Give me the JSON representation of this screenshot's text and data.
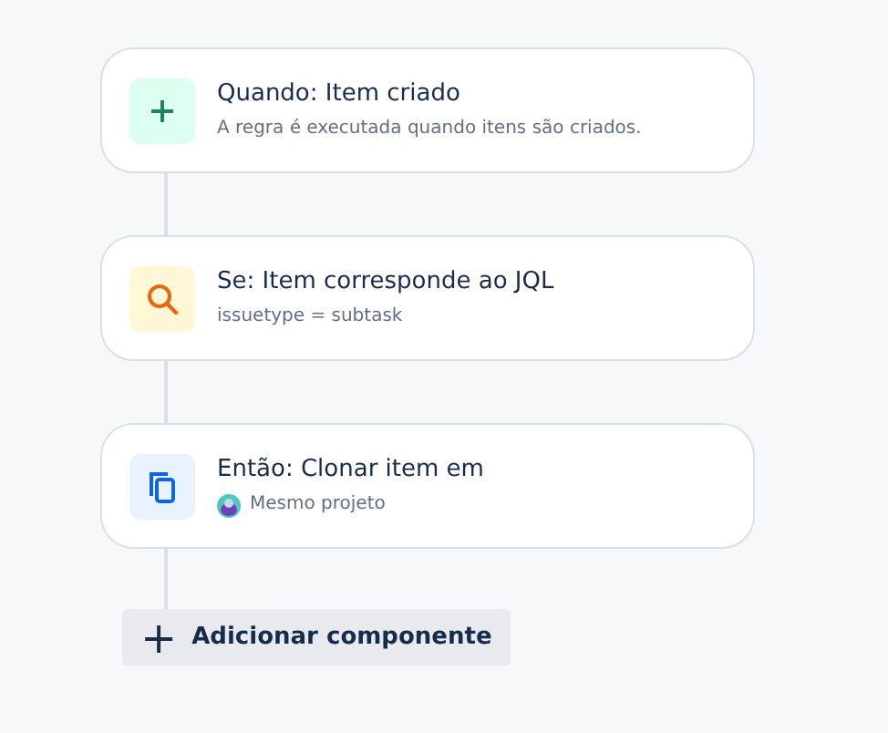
{
  "steps": [
    {
      "kind": "trigger",
      "title": "Quando: Item criado",
      "subtitle": {
        "kind": "text",
        "text": "A regra é executada quando itens são criados."
      }
    },
    {
      "kind": "condition",
      "title": "Se: Item corresponde ao JQL",
      "subtitle": {
        "kind": "text",
        "text": "issuetype = subtask"
      }
    },
    {
      "kind": "action",
      "title": "Então: Clonar item em",
      "subtitle": {
        "kind": "project",
        "text": "Mesmo projeto"
      }
    }
  ],
  "add_button": {
    "icon": "+",
    "label": "Adicionar componente"
  }
}
